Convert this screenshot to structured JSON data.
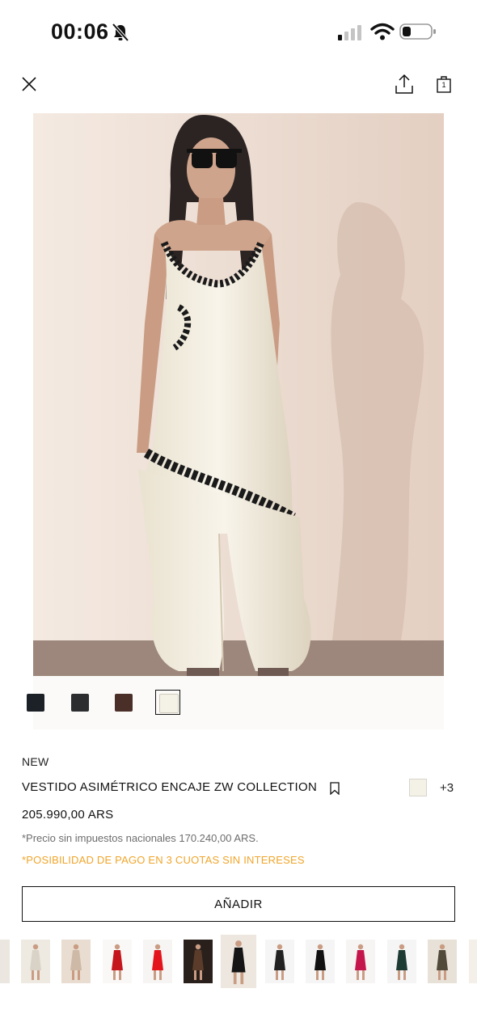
{
  "status_bar": {
    "time": "00:06",
    "icons": [
      "bell-slash-icon",
      "cellular-signal-icon",
      "wifi-icon",
      "battery-icon"
    ]
  },
  "toolbar": {
    "close_icon": "close-icon",
    "share_icon": "share-icon",
    "bag_icon": "shopping-bag-icon",
    "bag_count": "1"
  },
  "product": {
    "badge": "NEW",
    "name": "VESTIDO ASIMÉTRICO ENCAJE ZW COLLECTION",
    "price": "205.990,00 ARS",
    "tax_note": "*Precio sin impuestos nacionales 170.240,00 ARS.",
    "installments_note": "*POSIBILIDAD DE PAGO EN 3 CUOTAS SIN INTERESES",
    "more_colors": "+3",
    "add_button": "AÑADIR",
    "selected_color_hex": "#f4f1e6",
    "installments_color": "#f0a52a"
  },
  "swatches": [
    {
      "color": "#1c2128"
    },
    {
      "color": "#2b2d2f"
    },
    {
      "color": "#4a2f28"
    },
    {
      "color": "#f4f1e6",
      "selected": true
    }
  ],
  "thumbnails": [
    {
      "look": "white-dress",
      "selected": false
    },
    {
      "look": "beige-dress",
      "selected": false
    },
    {
      "look": "red-dress",
      "selected": false
    },
    {
      "look": "red-minidress",
      "selected": false
    },
    {
      "look": "brown-dress",
      "selected": false
    },
    {
      "look": "black-slip-white-pants",
      "selected": true
    },
    {
      "look": "black-sequin-dress",
      "selected": false
    },
    {
      "look": "black-minidress",
      "selected": false
    },
    {
      "look": "magenta-dress",
      "selected": false
    },
    {
      "look": "green-dress",
      "selected": false
    },
    {
      "look": "olive-suit",
      "selected": false
    },
    {
      "look": "orange-dress",
      "selected": false
    }
  ]
}
